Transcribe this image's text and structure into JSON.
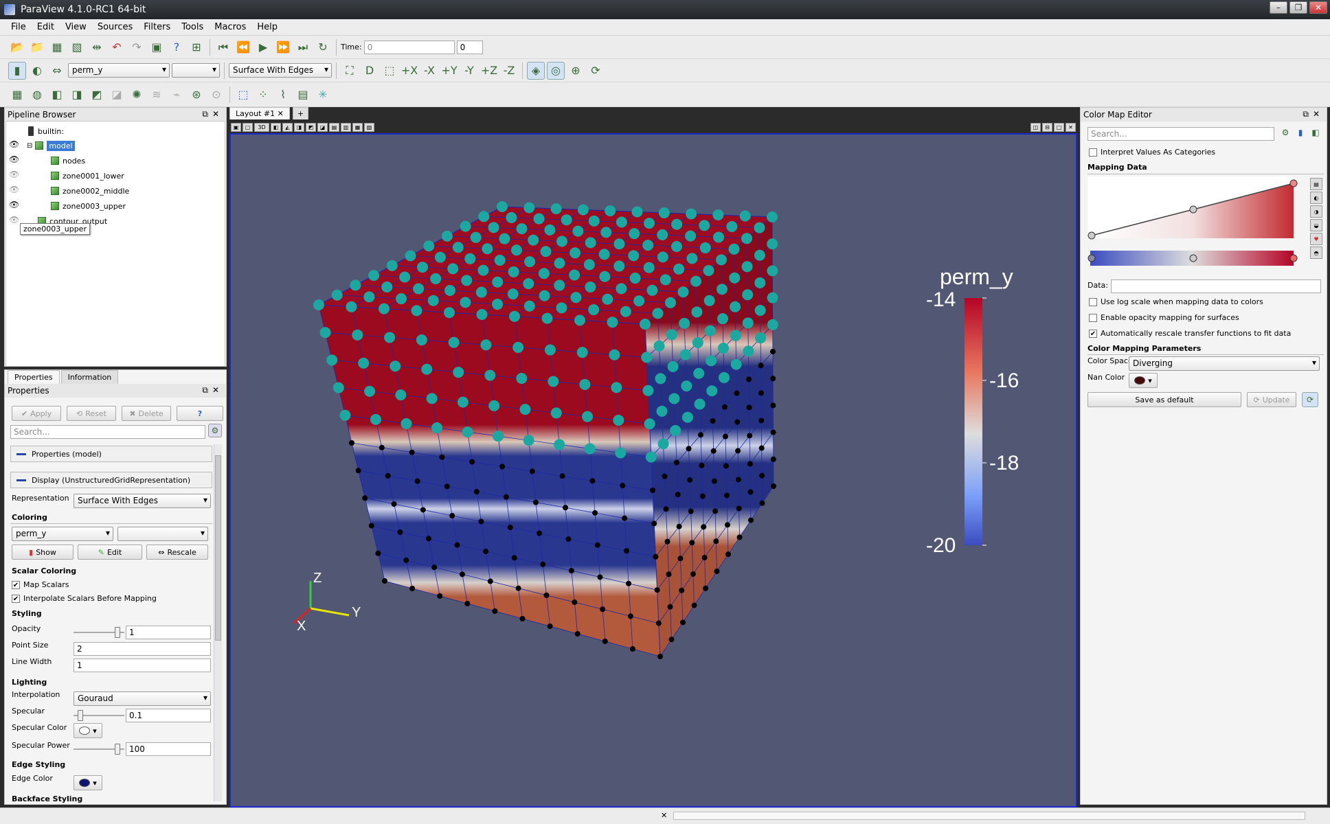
{
  "window": {
    "title": "ParaView 4.1.0-RC1 64-bit",
    "buttons": [
      "–",
      "❐",
      "✕"
    ]
  },
  "menu": [
    "File",
    "Edit",
    "View",
    "Sources",
    "Filters",
    "Tools",
    "Macros",
    "Help"
  ],
  "toolbar": {
    "time_label": "Time:",
    "time_value": "0",
    "time_step": "0",
    "array_selector": "perm_y",
    "component_selector": "",
    "representation_selector": "Surface With Edges"
  },
  "pipeline": {
    "title": "Pipeline Browser",
    "items": [
      {
        "label": "builtin:"
      },
      {
        "label": "model"
      },
      {
        "label": "nodes"
      },
      {
        "label": "zone0001_lower"
      },
      {
        "label": "zone0002_middle"
      },
      {
        "label": "zone0003_upper"
      },
      {
        "label": "contour_output"
      }
    ],
    "tooltip": "zone0003_upper"
  },
  "props": {
    "tabs": [
      "Properties",
      "Information"
    ],
    "title": "Properties",
    "apply": "Apply",
    "reset": "Reset",
    "delete": "Delete",
    "help": "?",
    "search_placeholder": "Search...",
    "group_model": "Properties (model)",
    "group_display": "Display (UnstructuredGridRepresentation)",
    "representation_label": "Representation",
    "representation_value": "Surface With Edges",
    "coloring_title": "Coloring",
    "coloring_array": "perm_y",
    "coloring_component": "",
    "show": "Show",
    "edit": "Edit",
    "rescale": "Rescale",
    "scalar_title": "Scalar Coloring",
    "map_scalars": "Map Scalars",
    "interpolate": "Interpolate Scalars Before Mapping",
    "styling_title": "Styling",
    "opacity_label": "Opacity",
    "opacity_value": "1",
    "opacity_level": 1,
    "pointsize_label": "Point Size",
    "pointsize_value": "2",
    "linewidth_label": "Line Width",
    "linewidth_value": "1",
    "lighting_title": "Lighting",
    "interp_label": "Interpolation",
    "interp_value": "Gouraud",
    "specular_label": "Specular",
    "specular_value": "0.1",
    "specular_level": 0.1,
    "specular_color_label": "Specular Color",
    "specular_power_label": "Specular Power",
    "specular_power_value": "100",
    "edge_title": "Edge Styling",
    "edge_color_label": "Edge Color",
    "backface_title": "Backface Styling"
  },
  "layout": {
    "tab": "Layout #1",
    "add": "+",
    "mode": "3D"
  },
  "scene": {
    "legend_title": "perm_y",
    "legend_ticks": [
      "-14",
      "-16",
      "-18",
      "-20"
    ],
    "axes": {
      "x": "X",
      "y": "Y",
      "z": "Z"
    },
    "colors": {
      "background": "#525773",
      "red": "#9b0a1e",
      "blue": "#26338a",
      "brown": "#b45a3c",
      "point_cyan": "#1aa8a0"
    }
  },
  "cme": {
    "title": "Color Map Editor",
    "search_placeholder": "Search...",
    "categories": "Interpret Values As Categories",
    "mapping": "Mapping Data",
    "data_label": "Data:",
    "data_value": "",
    "log": "Use log scale when mapping data to colors",
    "opacity": "Enable opacity mapping for surfaces",
    "autorescale": "Automatically rescale transfer functions to fit data",
    "params": "Color Mapping Parameters",
    "space_label": "Color Space",
    "space_value": "Diverging",
    "nan_label": "Nan Color",
    "save": "Save as default",
    "update": "Update"
  }
}
